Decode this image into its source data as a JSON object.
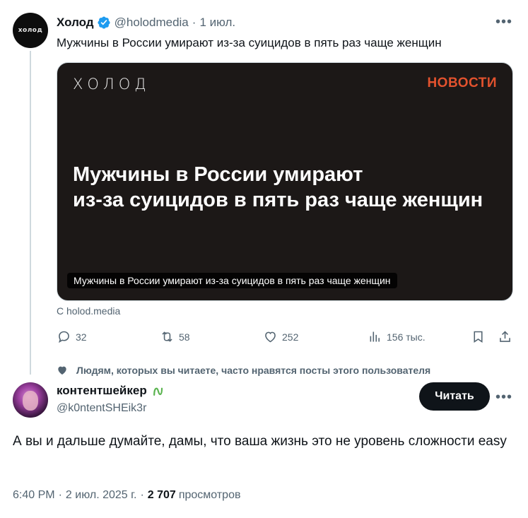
{
  "tweet": {
    "author_name": "Холод",
    "avatar_text": "холод",
    "handle": "@holodmedia",
    "date": "1 июл.",
    "text": "Мужчины в России умирают из-за суицидов в пять раз чаще женщин",
    "media": {
      "logo": "холод",
      "tag": "НОВОСТИ",
      "headline_line1": "Мужчины в России умирают",
      "headline_line2": "из-за суицидов в пять раз чаще женщин",
      "caption": "Мужчины в России умирают из-за суицидов в пять раз чаще женщин"
    },
    "source": "С holod.media",
    "actions": {
      "replies": "32",
      "reposts": "58",
      "likes": "252",
      "views": "156 тыс."
    }
  },
  "social_context": "Людям, которых вы читаете, часто нравятся посты этого пользователя",
  "reply": {
    "author_name": "контентшейкер",
    "handle": "@k0ntentSHEik3r",
    "follow_label": "Читать",
    "text": "А вы и дальше думайте, дамы, что ваша жизнь это не уровень сложности easy",
    "time": "6:40 PM",
    "date": "2 июл. 2025 г.",
    "views_count": "2 707",
    "views_label": "просмотров"
  },
  "colors": {
    "text_primary": "#0f1419",
    "text_secondary": "#536471",
    "verified_blue": "#1d9bf0",
    "news_tag": "#e2522e",
    "card_bg": "#1c1817"
  }
}
